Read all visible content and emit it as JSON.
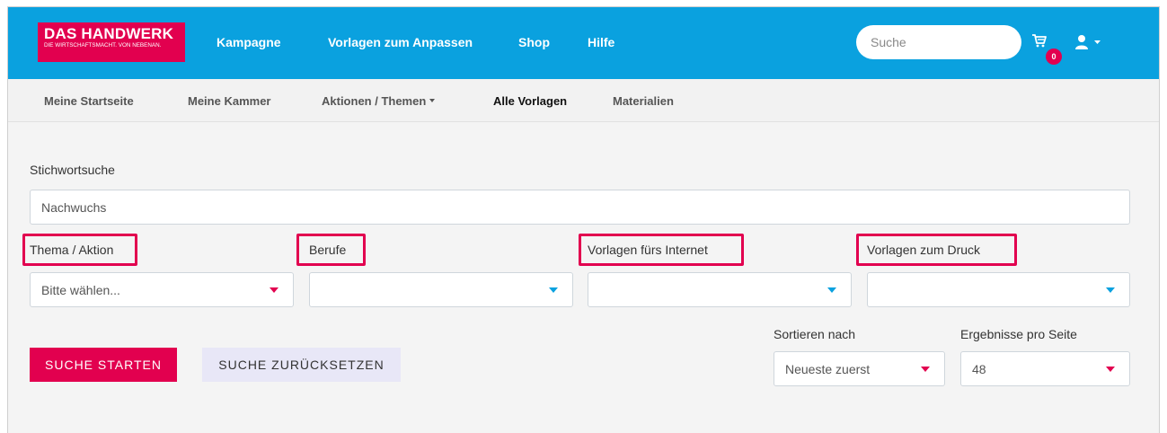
{
  "header": {
    "logo_title": "DAS HANDWERK",
    "logo_subtitle": "DIE WIRTSCHAFTSMACHT. VON NEBENAN.",
    "nav": [
      "Kampagne",
      "Vorlagen zum Anpassen",
      "Shop",
      "Hilfe"
    ],
    "search_placeholder": "Suche",
    "cart_count": "0",
    "colors": {
      "bar": "#0aa1df",
      "accent": "#e2004f"
    }
  },
  "subnav": {
    "items": [
      "Meine Startseite",
      "Meine Kammer",
      "Aktionen / Themen",
      "Alle Vorlagen",
      "Materialien"
    ],
    "active": "Alle Vorlagen"
  },
  "form": {
    "keyword_label": "Stichwortsuche",
    "keyword_value": "Nachwuchs",
    "filters": [
      {
        "label": "Thema / Aktion",
        "value": "Bitte wählen..."
      },
      {
        "label": "Berufe",
        "value": ""
      },
      {
        "label": "Vorlagen fürs Internet",
        "value": ""
      },
      {
        "label": "Vorlagen zum Druck",
        "value": ""
      }
    ],
    "sort_label": "Sortieren nach",
    "sort_value": "Neueste zuerst",
    "per_page_label": "Ergebnisse pro Seite",
    "per_page_value": "48",
    "start_button": "SUCHE STARTEN",
    "reset_button": "SUCHE ZURÜCKSETZEN"
  }
}
